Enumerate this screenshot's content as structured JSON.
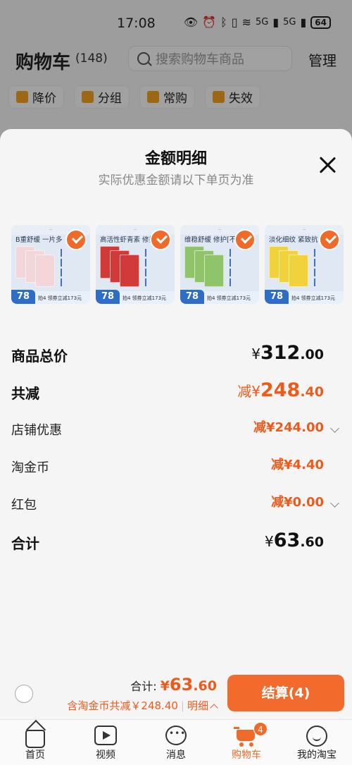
{
  "status_bar": {
    "time": "17:08",
    "network": "5G",
    "battery": "64"
  },
  "cart_header": {
    "title": "购物车",
    "count": "(148)",
    "search_placeholder": "搜索购物车商品",
    "manage_label": "管理",
    "filters": [
      {
        "label": "降价",
        "icon": "price-drop-icon"
      },
      {
        "label": "分组",
        "icon": "folder-icon"
      },
      {
        "label": "常购",
        "icon": "cart-icon"
      },
      {
        "label": "失效",
        "icon": "invalid-tag-icon"
      }
    ]
  },
  "sheet": {
    "title": "金额明细",
    "subtitle": "实际优惠金额请以下单页为准",
    "products": [
      {
        "name": "B重舒缓 一片多",
        "price": "78",
        "promo": "拍4 领券立减173元",
        "color": "#f3d6da",
        "selected": true
      },
      {
        "name": "高活性虾青素 修护",
        "price": "78",
        "promo": "拍4 领券立减173元",
        "color": "#d23a3a",
        "selected": true
      },
      {
        "name": "维稳舒缓 修护[不含",
        "price": "78",
        "promo": "拍4 领券立减173元",
        "color": "#8fc46a",
        "selected": true
      },
      {
        "name": "淡化细纹 紧致抗",
        "price": "78",
        "promo": "拍4 领券立减173元",
        "color": "#f2d23a",
        "selected": true
      }
    ],
    "rows": {
      "subtotal": {
        "label": "商品总价",
        "prefix": "¥",
        "int": "312",
        "dec": ".00"
      },
      "total_discount": {
        "label": "共减",
        "prefix": "减¥",
        "int": "248",
        "dec": ".40"
      },
      "store_discount": {
        "label": "店铺优惠",
        "value": "减¥244.00"
      },
      "taojinbi": {
        "label": "淘金币",
        "value": "减¥4.40"
      },
      "red_packet": {
        "label": "红包",
        "value": "减¥0.00"
      },
      "total": {
        "label": "合计",
        "prefix": "¥",
        "int": "63",
        "dec": ".60"
      }
    }
  },
  "footer": {
    "total_label": "合计:",
    "total_prefix": "¥",
    "total_int": "63",
    "total_dec": ".60",
    "saving_text": "含淘金币共减￥248.40",
    "detail_label": "明细",
    "checkout_label": "结算(4)"
  },
  "tabbar": {
    "tabs": [
      {
        "label": "首页"
      },
      {
        "label": "视频"
      },
      {
        "label": "消息"
      },
      {
        "label": "购物车",
        "badge": "4"
      },
      {
        "label": "我的淘宝"
      }
    ]
  },
  "colors": {
    "accent": "#f06a2a",
    "discount": "#ee5a1b",
    "brand_blue": "#2f6ec6"
  }
}
